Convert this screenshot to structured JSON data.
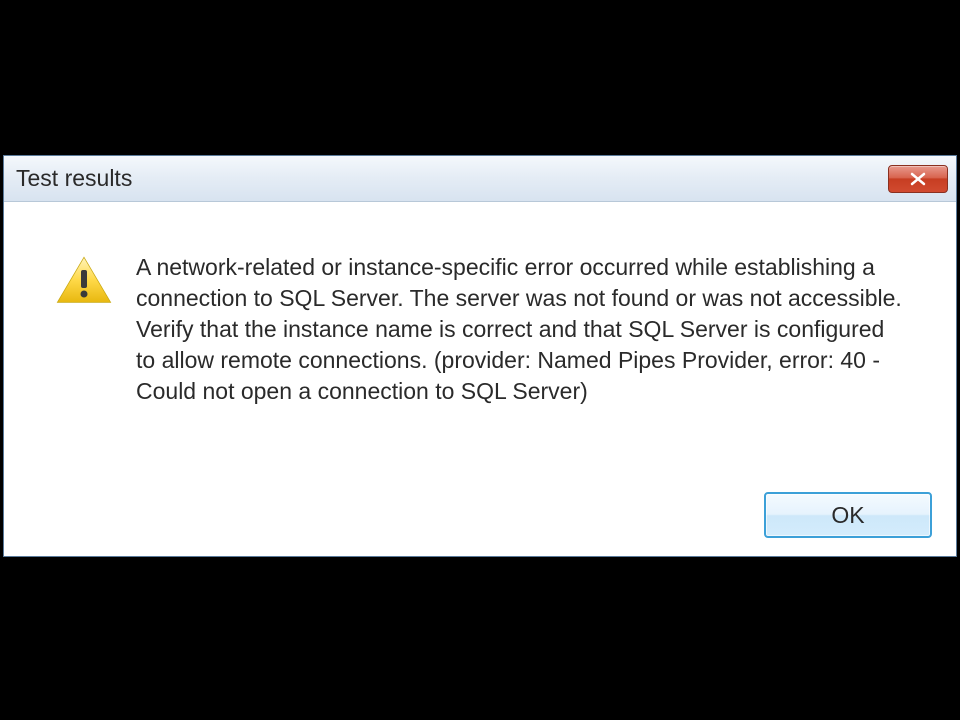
{
  "dialog": {
    "title": "Test results",
    "message": "A network-related or instance-specific error occurred while establishing a connection to SQL Server. The server was not found or was not accessible. Verify that the instance name is correct and that SQL Server is configured to allow remote connections. (provider: Named Pipes Provider, error: 40 - Could not open a connection to SQL Server)",
    "ok_label": "OK"
  }
}
